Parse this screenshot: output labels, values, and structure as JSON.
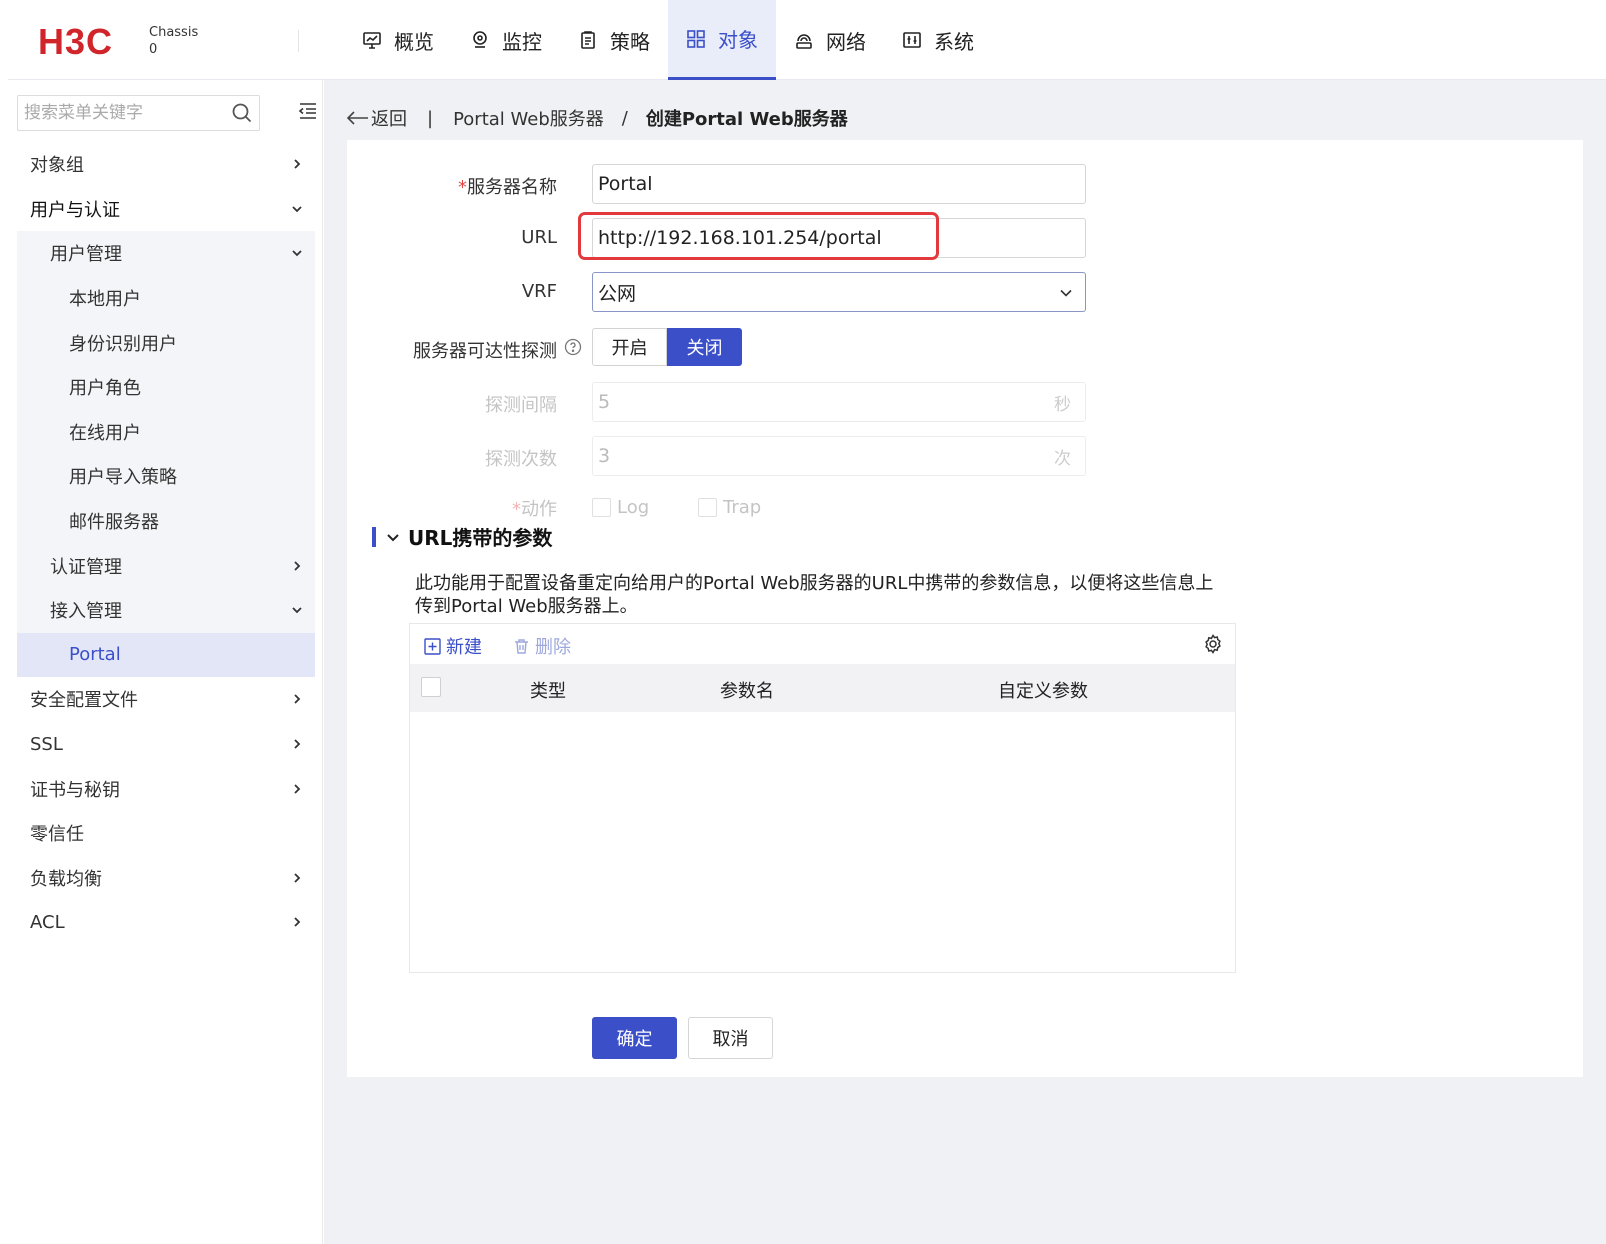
{
  "header": {
    "logo_text": "H3C",
    "chassis_label": "Chassis",
    "chassis_value": "0",
    "nav": [
      {
        "label": "概览",
        "icon": "monitor-chart-icon"
      },
      {
        "label": "监控",
        "icon": "location-pin-icon"
      },
      {
        "label": "策略",
        "icon": "clipboard-icon"
      },
      {
        "label": "对象",
        "icon": "grid-icon",
        "active": true
      },
      {
        "label": "网络",
        "icon": "network-cloud-icon"
      },
      {
        "label": "系统",
        "icon": "sliders-icon"
      }
    ]
  },
  "sidebar": {
    "search_placeholder": "搜索菜单关键字",
    "items": [
      {
        "label": "对象组",
        "level": 0,
        "chevron": "right"
      },
      {
        "label": "用户与认证",
        "level": 0,
        "chevron": "down"
      },
      {
        "label": "用户管理",
        "level": 1,
        "chevron": "down"
      },
      {
        "label": "本地用户",
        "level": 2
      },
      {
        "label": "身份识别用户",
        "level": 2
      },
      {
        "label": "用户角色",
        "level": 2
      },
      {
        "label": "在线用户",
        "level": 2
      },
      {
        "label": "用户导入策略",
        "level": 2
      },
      {
        "label": "邮件服务器",
        "level": 2
      },
      {
        "label": "认证管理",
        "level": 1,
        "chevron": "right"
      },
      {
        "label": "接入管理",
        "level": 1,
        "chevron": "down"
      },
      {
        "label": "Portal",
        "level": 2,
        "selected": true
      },
      {
        "label": "安全配置文件",
        "level": 0,
        "chevron": "right"
      },
      {
        "label": "SSL",
        "level": 0,
        "chevron": "right"
      },
      {
        "label": "证书与秘钥",
        "level": 0,
        "chevron": "right"
      },
      {
        "label": "零信任",
        "level": 0
      },
      {
        "label": "负载均衡",
        "level": 0,
        "chevron": "right"
      },
      {
        "label": "ACL",
        "level": 0,
        "chevron": "right"
      }
    ]
  },
  "breadcrumb": {
    "back": "返回",
    "parent": "Portal Web服务器",
    "current": "创建Portal Web服务器"
  },
  "form": {
    "required_mark": "*",
    "name_label": "服务器名称",
    "name_value": "Portal",
    "url_label": "URL",
    "url_value": "http://192.168.101.254/portal",
    "vrf_label": "VRF",
    "vrf_value": "公网",
    "probe_label": "服务器可达性探测",
    "probe_on": "开启",
    "probe_off": "关闭",
    "interval_label": "探测间隔",
    "interval_value": "5",
    "interval_unit": "秒",
    "count_label": "探测次数",
    "count_value": "3",
    "count_unit": "次",
    "action_label": "动作",
    "action_log": "Log",
    "action_trap": "Trap"
  },
  "params_section": {
    "title": "URL携带的参数",
    "description": "此功能用于配置设备重定向给用户的Portal Web服务器的URL中携带的参数信息，以便将这些信息上传到Portal Web服务器上。",
    "new_button": "新建",
    "delete_button": "删除",
    "columns": [
      "类型",
      "参数名",
      "自定义参数"
    ],
    "rows": []
  },
  "footer": {
    "ok": "确定",
    "cancel": "取消"
  },
  "colors": {
    "accent": "#3b4fc9",
    "logo_red": "#d0262b",
    "highlight_red": "#e2393d"
  }
}
